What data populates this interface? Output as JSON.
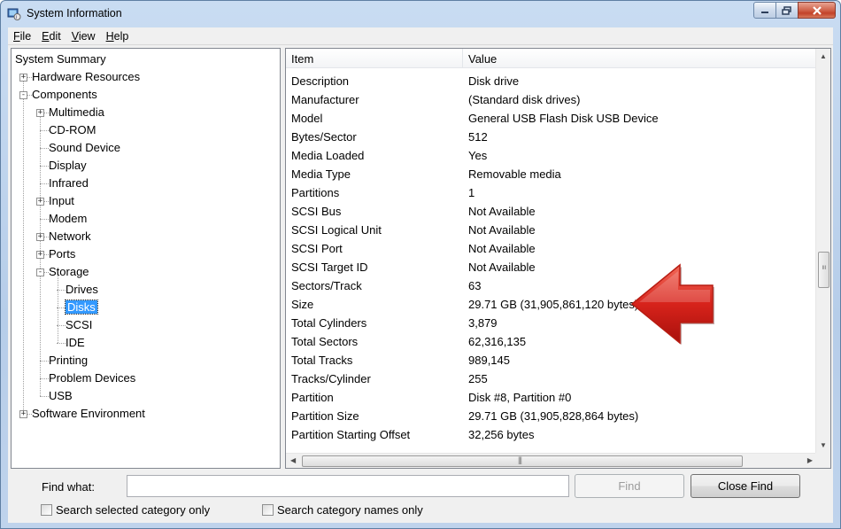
{
  "window": {
    "title": "System Information"
  },
  "menu": [
    "File",
    "Edit",
    "View",
    "Help"
  ],
  "tree": [
    {
      "label": "System Summary"
    },
    {
      "label": "Hardware Resources"
    },
    {
      "label": "Components"
    },
    {
      "label": "Multimedia"
    },
    {
      "label": "CD-ROM"
    },
    {
      "label": "Sound Device"
    },
    {
      "label": "Display"
    },
    {
      "label": "Infrared"
    },
    {
      "label": "Input"
    },
    {
      "label": "Modem"
    },
    {
      "label": "Network"
    },
    {
      "label": "Ports"
    },
    {
      "label": "Storage"
    },
    {
      "label": "Drives"
    },
    {
      "label": "Disks"
    },
    {
      "label": "SCSI"
    },
    {
      "label": "IDE"
    },
    {
      "label": "Printing"
    },
    {
      "label": "Problem Devices"
    },
    {
      "label": "USB"
    },
    {
      "label": "Software Environment"
    }
  ],
  "list": {
    "columns": [
      "Item",
      "Value"
    ],
    "rows": [
      [
        "Description",
        "Disk drive"
      ],
      [
        "Manufacturer",
        "(Standard disk drives)"
      ],
      [
        "Model",
        "General USB Flash Disk USB Device"
      ],
      [
        "Bytes/Sector",
        "512"
      ],
      [
        "Media Loaded",
        "Yes"
      ],
      [
        "Media Type",
        "Removable media"
      ],
      [
        "Partitions",
        "1"
      ],
      [
        "SCSI Bus",
        "Not Available"
      ],
      [
        "SCSI Logical Unit",
        "Not Available"
      ],
      [
        "SCSI Port",
        "Not Available"
      ],
      [
        "SCSI Target ID",
        "Not Available"
      ],
      [
        "Sectors/Track",
        "63"
      ],
      [
        "Size",
        "29.71 GB (31,905,861,120 bytes)"
      ],
      [
        "Total Cylinders",
        "3,879"
      ],
      [
        "Total Sectors",
        "62,316,135"
      ],
      [
        "Total Tracks",
        "989,145"
      ],
      [
        "Tracks/Cylinder",
        "255"
      ],
      [
        "Partition",
        "Disk #8, Partition #0"
      ],
      [
        "Partition Size",
        "29.71 GB (31,905,828,864 bytes)"
      ],
      [
        "Partition Starting Offset",
        "32,256 bytes"
      ]
    ]
  },
  "find": {
    "label": "Find what:",
    "value": "",
    "find_button": "Find",
    "close_button": "Close Find",
    "search_selected": "Search selected category only",
    "search_names": "Search category names only"
  }
}
